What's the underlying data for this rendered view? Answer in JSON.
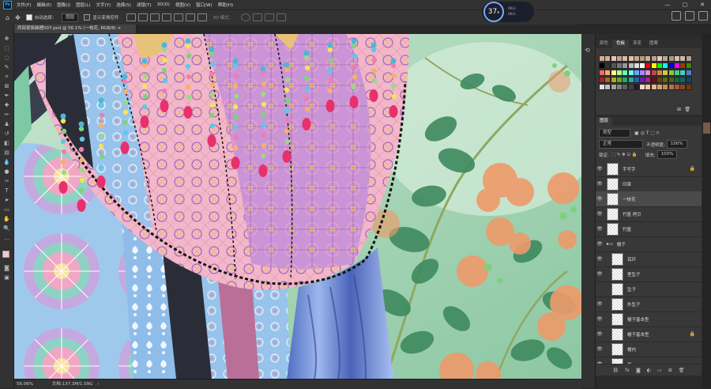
{
  "app": {
    "logo": "Ps"
  },
  "menu": [
    "文件(F)",
    "编辑(E)",
    "图像(I)",
    "图层(L)",
    "文字(Y)",
    "选择(S)",
    "滤镜(T)",
    "3D(D)",
    "视图(V)",
    "窗口(W)",
    "帮助(H)"
  ],
  "window_controls": [
    "—",
    "▢",
    "✕"
  ],
  "options": {
    "auto_select_label": "自动选择：",
    "auto_select_target": "图层",
    "show_transform_label": "显示变换控件",
    "mode_3d_label": "3D 模式："
  },
  "hud": {
    "value": "37",
    "unit": "x",
    "rate1": "0K/s",
    "rate2": "0K/s"
  },
  "document": {
    "tab_title": "西部豪族妯娌007.psd @ 56.1% (一枝花, RGB/8)"
  },
  "status": {
    "zoom": "56.06%",
    "doc_size": "文档:137.3M/1.09G"
  },
  "swatches_panel": {
    "tabs": [
      "颜色",
      "色板",
      "渐变",
      "图案"
    ],
    "active_tab": 1
  },
  "layers_panel": {
    "title": "图层",
    "kind_filter": "类型",
    "blend_mode": "正常",
    "opacity_label": "不透明度:",
    "opacity_value": "100%",
    "lock_label": "锁定:",
    "fill_label": "填充:",
    "fill_value": "100%",
    "layers": [
      {
        "name": "手写字",
        "visible": true,
        "locked": true
      },
      {
        "name": "印章",
        "visible": true,
        "locked": false
      },
      {
        "name": "一枝花",
        "visible": true,
        "locked": false
      },
      {
        "name": "竹篮 拷贝",
        "visible": true,
        "locked": false
      },
      {
        "name": "竹篮",
        "visible": true,
        "locked": false
      },
      {
        "name": "帽子",
        "visible": true,
        "locked": false,
        "group": true
      },
      {
        "name": "耳环",
        "visible": true,
        "locked": false
      },
      {
        "name": "里坠子",
        "visible": true,
        "locked": false
      },
      {
        "name": "坠子",
        "visible": false,
        "locked": false
      },
      {
        "name": "外坠子",
        "visible": true,
        "locked": false
      },
      {
        "name": "帽子基本型",
        "visible": true,
        "locked": false
      },
      {
        "name": "帽子基本型",
        "visible": true,
        "locked": true
      },
      {
        "name": "帽内",
        "visible": true,
        "locked": false
      },
      {
        "name": "发",
        "visible": true,
        "locked": false
      }
    ]
  },
  "colors": {
    "accent": "#31a8ff",
    "panel": "#383838",
    "bg": "#282828"
  }
}
